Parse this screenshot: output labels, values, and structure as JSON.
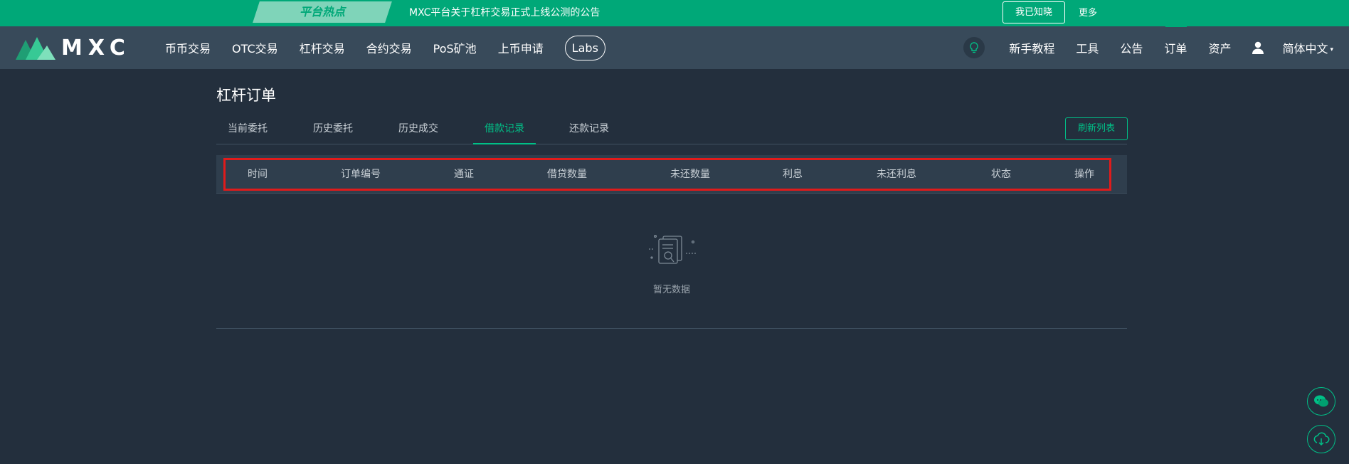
{
  "announcement": {
    "tag": "平台热点",
    "message": "MXC平台关于杠杆交易正式上线公测的公告",
    "ack_button": "我已知晓",
    "more": "更多"
  },
  "nav": {
    "logo_text": "MXC",
    "left_items": [
      "币币交易",
      "OTC交易",
      "杠杆交易",
      "合约交易",
      "PoS矿池",
      "上币申请"
    ],
    "labs": "Labs",
    "right_items": [
      "新手教程",
      "工具",
      "公告",
      "订单",
      "资产"
    ],
    "active_right": "订单",
    "language": "简体中文"
  },
  "page": {
    "title": "杠杆订单",
    "tabs": [
      "当前委托",
      "历史委托",
      "历史成交",
      "借款记录",
      "还款记录"
    ],
    "active_tab": "借款记录",
    "refresh_button": "刷新列表"
  },
  "table": {
    "columns": [
      "时间",
      "订单编号",
      "通证",
      "借贷数量",
      "未还数量",
      "利息",
      "未还利息",
      "状态",
      "操作"
    ],
    "rows": [],
    "empty_text": "暂无数据"
  },
  "colors": {
    "accent": "#00c087",
    "announce_bg": "#00a878",
    "nav_bg": "#384a5a",
    "page_bg": "#232f3d",
    "highlight": "#e01b1b"
  },
  "icons": [
    "logo-mountain-icon",
    "lightbulb-icon",
    "user-icon",
    "caret-down-icon",
    "empty-document-search-icon",
    "chat-icon",
    "cloud-download-icon"
  ]
}
